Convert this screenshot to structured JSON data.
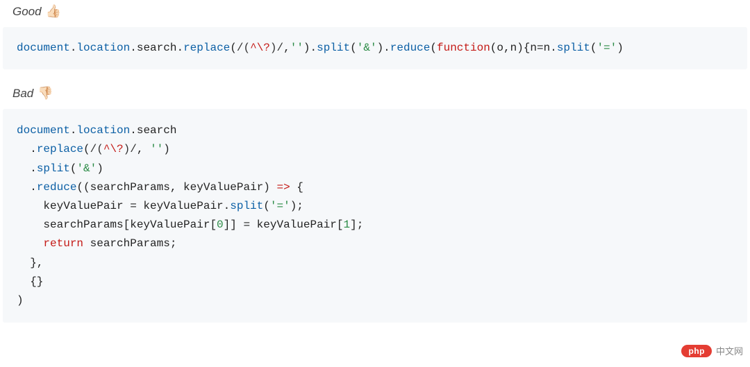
{
  "labels": {
    "good": "Good",
    "good_emoji": "👍🏻",
    "bad": "Bad",
    "bad_emoji": "👎🏻"
  },
  "code_good": {
    "tokens": [
      {
        "t": "document",
        "c": "tok-ident"
      },
      {
        "t": ".",
        "c": "tok-dot"
      },
      {
        "t": "location",
        "c": "tok-prop"
      },
      {
        "t": ".",
        "c": "tok-dot"
      },
      {
        "t": "search",
        "c": "tok-plain"
      },
      {
        "t": ".",
        "c": "tok-dot"
      },
      {
        "t": "replace",
        "c": "tok-func"
      },
      {
        "t": "(",
        "c": "tok-paren"
      },
      {
        "t": "/(",
        "c": "tok-regex"
      },
      {
        "t": "^\\?",
        "c": "tok-regex-spec"
      },
      {
        "t": ")/",
        "c": "tok-regex"
      },
      {
        "t": ",",
        "c": "tok-paren"
      },
      {
        "t": "''",
        "c": "tok-str"
      },
      {
        "t": ").",
        "c": "tok-paren"
      },
      {
        "t": "split",
        "c": "tok-func"
      },
      {
        "t": "(",
        "c": "tok-paren"
      },
      {
        "t": "'&'",
        "c": "tok-str"
      },
      {
        "t": ").",
        "c": "tok-paren"
      },
      {
        "t": "reduce",
        "c": "tok-func"
      },
      {
        "t": "(",
        "c": "tok-paren"
      },
      {
        "t": "function",
        "c": "tok-key"
      },
      {
        "t": "(o,n){n=n.",
        "c": "tok-plain"
      },
      {
        "t": "split",
        "c": "tok-func"
      },
      {
        "t": "(",
        "c": "tok-paren"
      },
      {
        "t": "'='",
        "c": "tok-str"
      },
      {
        "t": ")",
        "c": "tok-paren"
      }
    ]
  },
  "code_bad": {
    "lines": [
      [
        {
          "t": "document",
          "c": "tok-ident"
        },
        {
          "t": ".",
          "c": "tok-dot"
        },
        {
          "t": "location",
          "c": "tok-prop"
        },
        {
          "t": ".",
          "c": "tok-dot"
        },
        {
          "t": "search",
          "c": "tok-plain"
        }
      ],
      [
        {
          "t": "  .",
          "c": "tok-plain"
        },
        {
          "t": "replace",
          "c": "tok-func"
        },
        {
          "t": "(",
          "c": "tok-paren"
        },
        {
          "t": "/(",
          "c": "tok-regex"
        },
        {
          "t": "^\\?",
          "c": "tok-regex-spec"
        },
        {
          "t": ")/",
          "c": "tok-regex"
        },
        {
          "t": ", ",
          "c": "tok-plain"
        },
        {
          "t": "''",
          "c": "tok-str"
        },
        {
          "t": ")",
          "c": "tok-paren"
        }
      ],
      [
        {
          "t": "  .",
          "c": "tok-plain"
        },
        {
          "t": "split",
          "c": "tok-func"
        },
        {
          "t": "(",
          "c": "tok-paren"
        },
        {
          "t": "'&'",
          "c": "tok-str"
        },
        {
          "t": ")",
          "c": "tok-paren"
        }
      ],
      [
        {
          "t": "  .",
          "c": "tok-plain"
        },
        {
          "t": "reduce",
          "c": "tok-func"
        },
        {
          "t": "((searchParams, keyValuePair) ",
          "c": "tok-plain"
        },
        {
          "t": "=>",
          "c": "tok-op"
        },
        {
          "t": " {",
          "c": "tok-plain"
        }
      ],
      [
        {
          "t": "    keyValuePair = keyValuePair.",
          "c": "tok-plain"
        },
        {
          "t": "split",
          "c": "tok-func"
        },
        {
          "t": "(",
          "c": "tok-paren"
        },
        {
          "t": "'='",
          "c": "tok-str"
        },
        {
          "t": ");",
          "c": "tok-paren"
        }
      ],
      [
        {
          "t": "    searchParams[keyValuePair[",
          "c": "tok-plain"
        },
        {
          "t": "0",
          "c": "tok-num"
        },
        {
          "t": "]] = keyValuePair[",
          "c": "tok-plain"
        },
        {
          "t": "1",
          "c": "tok-num"
        },
        {
          "t": "];",
          "c": "tok-plain"
        }
      ],
      [
        {
          "t": "    ",
          "c": "tok-plain"
        },
        {
          "t": "return",
          "c": "tok-key"
        },
        {
          "t": " searchParams;",
          "c": "tok-plain"
        }
      ],
      [
        {
          "t": "  },",
          "c": "tok-plain"
        }
      ],
      [
        {
          "t": "  {}",
          "c": "tok-plain"
        }
      ],
      [
        {
          "t": ")",
          "c": "tok-plain"
        }
      ]
    ]
  },
  "watermark": {
    "pill": "php",
    "text": "中文网"
  }
}
